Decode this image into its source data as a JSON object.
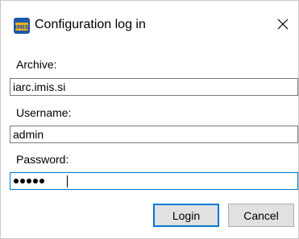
{
  "window": {
    "title": "Configuration log in",
    "icon": "imis-logo-icon",
    "close_icon": "close-icon"
  },
  "form": {
    "archive": {
      "label": "Archive:",
      "value": "iarc.imis.si"
    },
    "username": {
      "label": "Username:",
      "value": "admin"
    },
    "password": {
      "label": "Password:",
      "masked_length": 5,
      "focused": true
    }
  },
  "buttons": {
    "login": "Login",
    "cancel": "Cancel"
  },
  "colors": {
    "focus_border": "#0078d7",
    "button_face": "#e1e1e1",
    "logo_blue": "#1f56a8",
    "logo_gold": "#e8b020"
  }
}
